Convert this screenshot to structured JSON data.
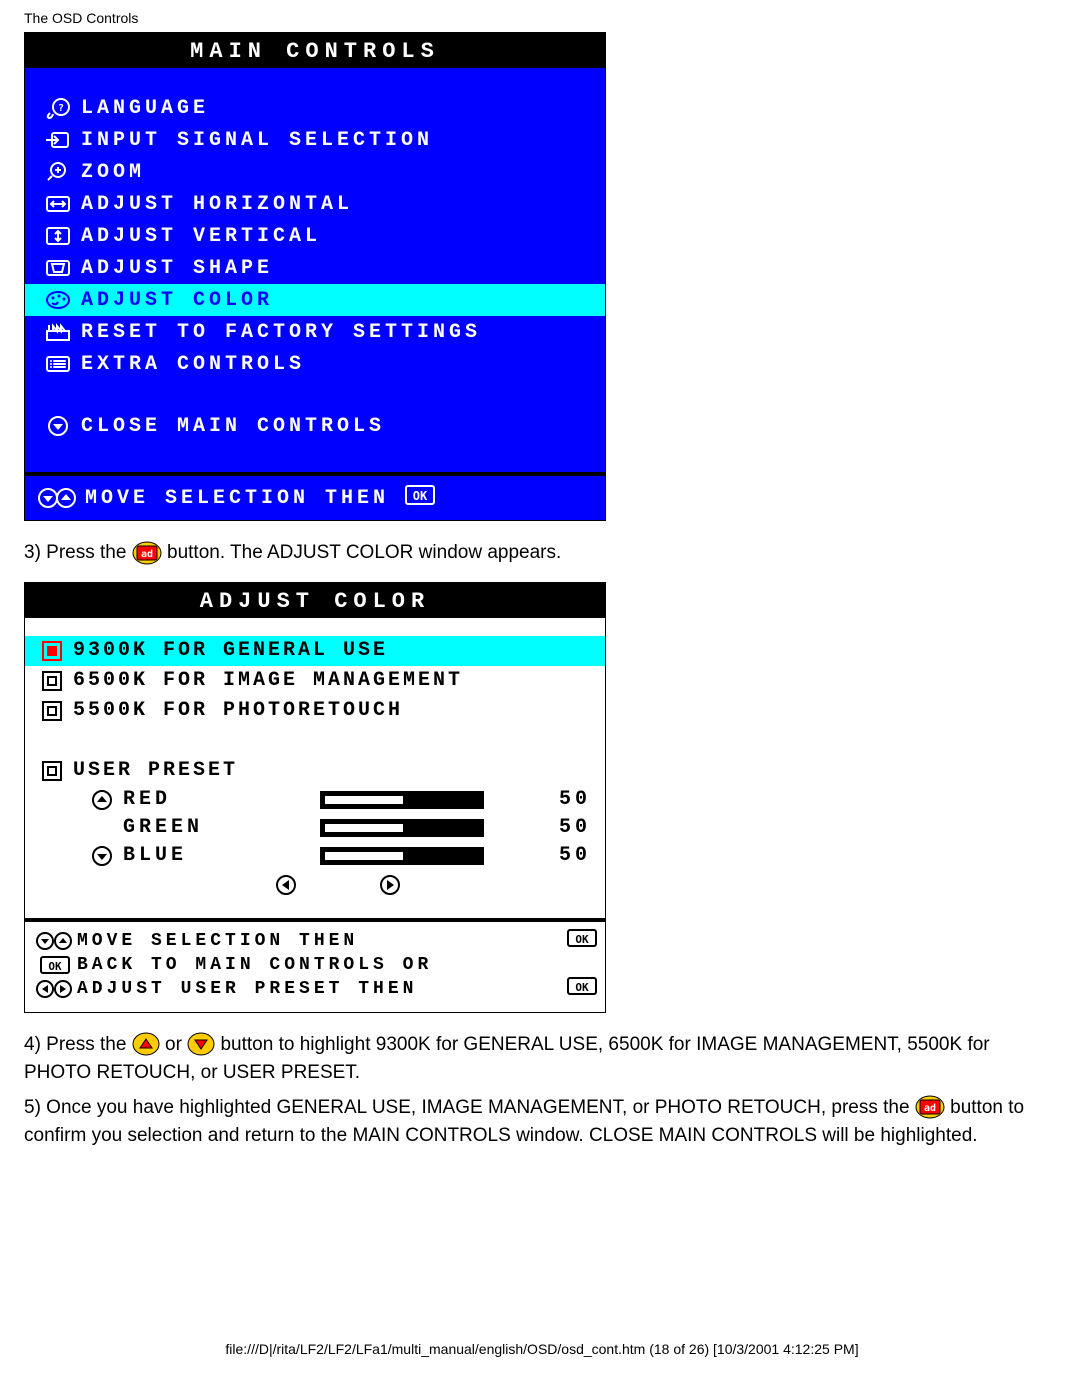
{
  "page_header": "The OSD Controls",
  "main_controls": {
    "title": "MAIN CONTROLS",
    "items": [
      {
        "label": "LANGUAGE",
        "icon": "globe-hand",
        "highlighted": false
      },
      {
        "label": "INPUT SIGNAL SELECTION",
        "icon": "input-arrow",
        "highlighted": false
      },
      {
        "label": "ZOOM",
        "icon": "magnifier-plus",
        "highlighted": false
      },
      {
        "label": "ADJUST HORIZONTAL",
        "icon": "horiz-arrows-box",
        "highlighted": false
      },
      {
        "label": "ADJUST VERTICAL",
        "icon": "vert-arrows-box",
        "highlighted": false
      },
      {
        "label": "ADJUST SHAPE",
        "icon": "shape-box",
        "highlighted": false
      },
      {
        "label": "ADJUST COLOR",
        "icon": "palette",
        "highlighted": true
      },
      {
        "label": "RESET TO FACTORY SETTINGS",
        "icon": "factory",
        "highlighted": false
      },
      {
        "label": "EXTRA CONTROLS",
        "icon": "list-box",
        "highlighted": false
      }
    ],
    "close_label": "CLOSE MAIN CONTROLS",
    "footer_hint": "MOVE SELECTION THEN"
  },
  "step3": {
    "prefix": "3) Press the ",
    "suffix": " button. The ADJUST COLOR window appears."
  },
  "adjust_color": {
    "title": "ADJUST COLOR",
    "presets": [
      {
        "label": "9300K FOR GENERAL USE",
        "highlighted": true,
        "red_bullet": true
      },
      {
        "label": "6500K FOR IMAGE MANAGEMENT",
        "highlighted": false,
        "red_bullet": false
      },
      {
        "label": "5500K FOR PHOTORETOUCH",
        "highlighted": false,
        "red_bullet": false
      }
    ],
    "user_preset_label": "USER PRESET",
    "channels": [
      {
        "name": "RED",
        "value": 50,
        "arrow": "up"
      },
      {
        "name": "GREEN",
        "value": 50,
        "arrow": "none"
      },
      {
        "name": "BLUE",
        "value": 50,
        "arrow": "down"
      }
    ],
    "footer_lines": {
      "l1": "MOVE SELECTION THEN",
      "l2": "BACK TO MAIN CONTROLS OR",
      "l3": "ADJUST USER PRESET THEN"
    }
  },
  "step4": "4) Press the  or  button to highlight 9300K for GENERAL USE, 6500K for IMAGE MANAGEMENT, 5500K for PHOTO RETOUCH, or USER PRESET.",
  "step4_pre": "4) Press the ",
  "step4_mid": " or ",
  "step4_post": " button to highlight 9300K for GENERAL USE, 6500K for IMAGE MANAGEMENT, 5500K for PHOTO RETOUCH, or USER PRESET.",
  "step5_pre": "5) Once you have highlighted GENERAL USE, IMAGE MANAGEMENT, or PHOTO RETOUCH, press the ",
  "step5_post": " button to confirm you selection and return to the MAIN CONTROLS window. CLOSE MAIN CONTROLS will be highlighted.",
  "footer_path": "file:///D|/rita/LF2/LF2/LFa1/multi_manual/english/OSD/osd_cont.htm (18 of 26) [10/3/2001 4:12:25 PM]"
}
